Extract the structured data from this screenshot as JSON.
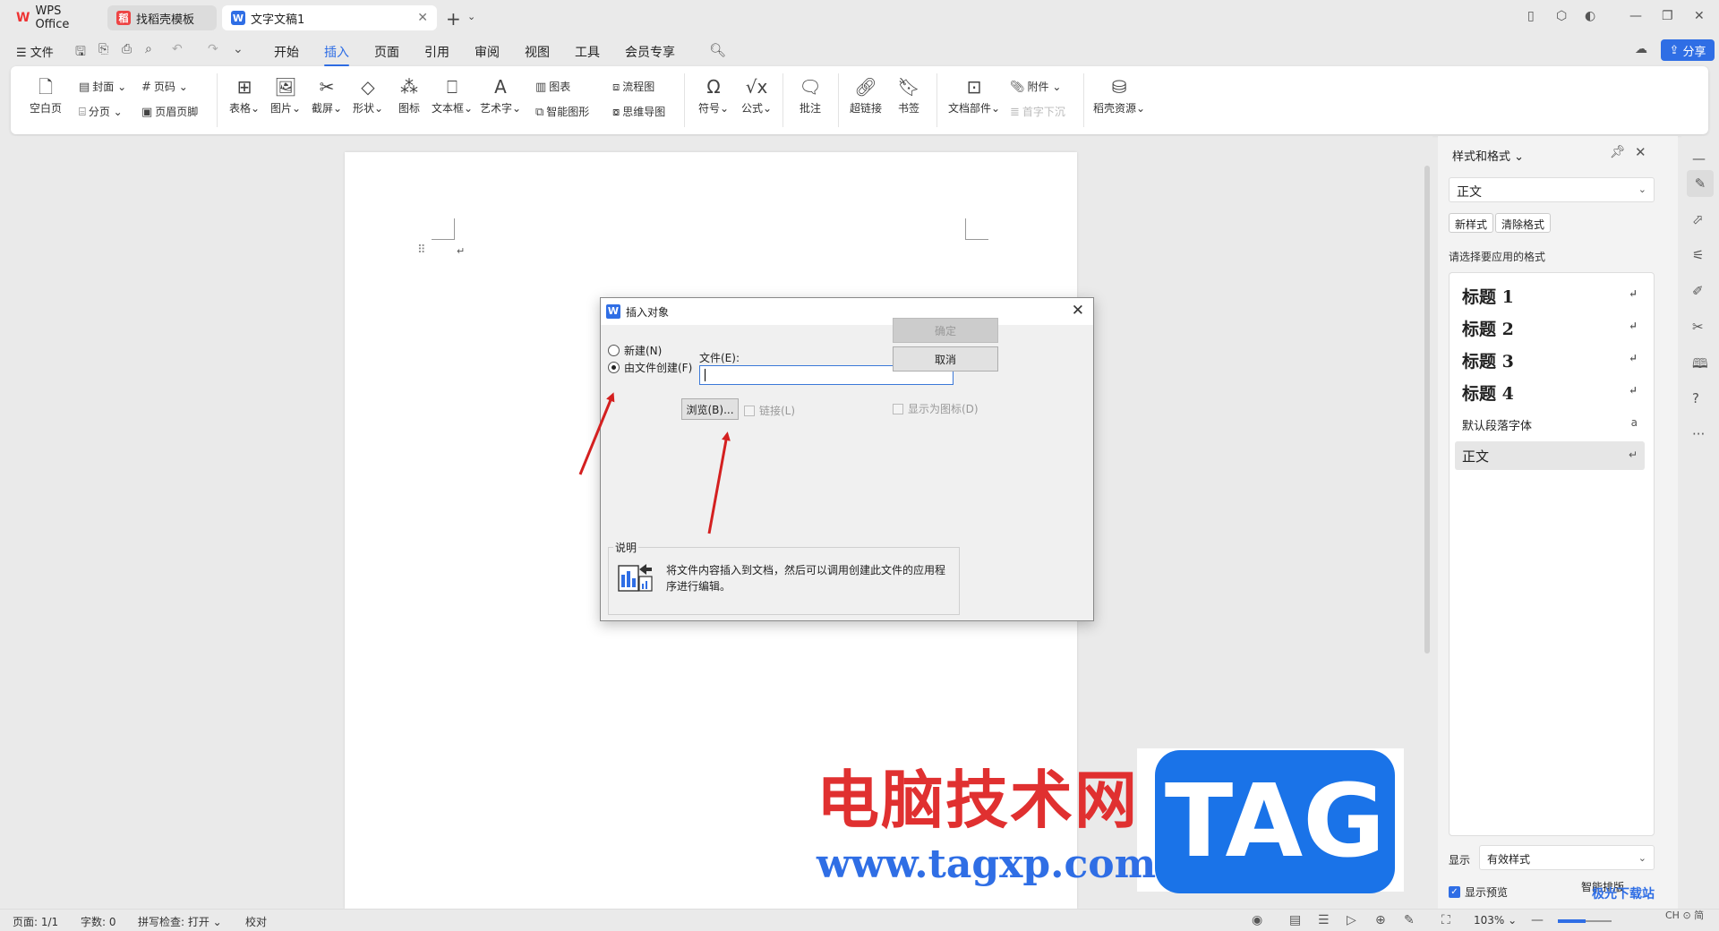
{
  "tabs": [
    {
      "label": "WPS Office"
    },
    {
      "label": "找稻壳模板"
    },
    {
      "label": "文字文稿1"
    }
  ],
  "menu": {
    "file": "文件",
    "tabs": [
      "开始",
      "插入",
      "页面",
      "引用",
      "审阅",
      "视图",
      "工具",
      "会员专享"
    ],
    "active_tab": "插入",
    "share": "分享"
  },
  "ribbon": {
    "blank_page": "空白页",
    "cover": "封面",
    "page_break": "分页",
    "page_number": "页码",
    "header_footer": "页眉页脚",
    "table": "表格",
    "picture": "图片",
    "screenshot": "截屏",
    "shape": "形状",
    "icon": "图标",
    "textbox": "文本框",
    "wordart": "艺术字",
    "chart": "图表",
    "smart_graphic": "智能图形",
    "flowchart": "流程图",
    "mindmap": "思维导图",
    "symbol": "符号",
    "formula": "公式",
    "comment": "批注",
    "hyperlink": "超链接",
    "bookmark": "书签",
    "doc_parts": "文档部件",
    "attachment": "附件",
    "drop_cap": "首字下沉",
    "resources": "稻壳资源"
  },
  "side_panel": {
    "title": "样式和格式",
    "current_style": "正文",
    "new_style": "新样式",
    "clear_format": "清除格式",
    "hint": "请选择要应用的格式",
    "styles": [
      "标题 1",
      "标题 2",
      "标题 3",
      "标题 4",
      "默认段落字体",
      "正文"
    ],
    "show_label": "显示",
    "show_value": "有效样式",
    "preview": "显示预览",
    "smart_layout": "智能排版"
  },
  "dialog": {
    "title": "插入对象",
    "radio_new": "新建(N)",
    "radio_from_file": "由文件创建(F)",
    "file_label": "文件(E):",
    "file_value": "",
    "browse": "浏览(B)...",
    "link": "链接(L)",
    "ok": "确定",
    "cancel": "取消",
    "show_as_icon": "显示为图标(D)",
    "desc_label": "说明",
    "desc_text": "将文件内容插入到文档，然后可以调用创建此文件的应用程序进行编辑。"
  },
  "status": {
    "page": "页面: 1/1",
    "words": "字数: 0",
    "spell": "拼写检查: 打开",
    "proof": "校对",
    "zoom": "103%",
    "zoom_fraction": 0.52
  },
  "watermark": {
    "cn": "电脑技术网",
    "url": "www.tagxp.com",
    "tag": "TAG",
    "corner": "极光下载站",
    "corner2": "CH ⊙ 简"
  },
  "colors": {
    "accent": "#2f6ee5",
    "arrow": "#d42020"
  }
}
